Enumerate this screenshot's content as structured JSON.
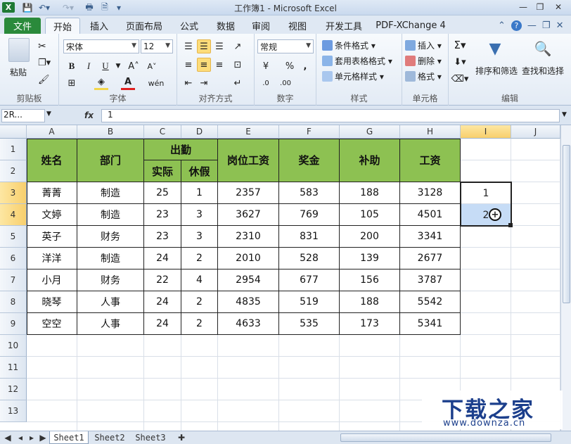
{
  "window": {
    "title": "工作簿1 - Microsoft Excel",
    "app_icon": "excel-icon",
    "quick_access": [
      "save-icon",
      "undo-icon",
      "redo-icon",
      "print-preview-icon",
      "new-icon",
      "customize-icon"
    ]
  },
  "tabs": [
    "文件",
    "开始",
    "插入",
    "页面布局",
    "公式",
    "数据",
    "审阅",
    "视图",
    "开发工具",
    "PDF-XChange 4"
  ],
  "active_tab": "开始",
  "ribbon": {
    "clipboard": {
      "paste": "粘贴",
      "label": "剪贴板"
    },
    "font": {
      "name": "宋体",
      "size": "12",
      "label": "字体",
      "font_color": "#e02020",
      "fill_color": "#f2d64b"
    },
    "alignment": {
      "label": "对齐方式"
    },
    "number": {
      "format": "常规",
      "label": "数字",
      "percent": "%",
      "comma": ","
    },
    "styles": {
      "conditional": "条件格式",
      "table_format": "套用表格格式",
      "cell_styles": "单元格样式",
      "label": "样式"
    },
    "cells": {
      "insert": "插入",
      "delete": "删除",
      "format": "格式",
      "label": "单元格"
    },
    "editing": {
      "sort_filter": "排序和筛选",
      "find_select": "查找和选择",
      "label": "编辑"
    }
  },
  "formula_bar": {
    "name_box": "2R...",
    "fx": "fx",
    "value": "1"
  },
  "columns": [
    "A",
    "B",
    "C",
    "D",
    "E",
    "F",
    "G",
    "H",
    "I",
    "J"
  ],
  "rows": [
    "1",
    "2",
    "3",
    "4",
    "5",
    "6",
    "7",
    "8",
    "9",
    "10",
    "11",
    "12",
    "13"
  ],
  "table": {
    "header_color": "#8dc152",
    "headers": {
      "name": "姓名",
      "dept": "部门",
      "attendance": "出勤",
      "actual": "实际",
      "leave": "休假",
      "base_pay": "岗位工资",
      "bonus": "奖金",
      "allowance": "补助",
      "salary": "工资"
    },
    "rows": [
      [
        "菁菁",
        "制造",
        "25",
        "1",
        "2357",
        "583",
        "188",
        "3128"
      ],
      [
        "文婷",
        "制造",
        "23",
        "3",
        "3627",
        "769",
        "105",
        "4501"
      ],
      [
        "英子",
        "财务",
        "23",
        "3",
        "2310",
        "831",
        "200",
        "3341"
      ],
      [
        "洋洋",
        "制造",
        "24",
        "2",
        "2010",
        "528",
        "139",
        "2677"
      ],
      [
        "小月",
        "财务",
        "22",
        "4",
        "2954",
        "677",
        "156",
        "3787"
      ],
      [
        "晓琴",
        "人事",
        "24",
        "2",
        "4835",
        "519",
        "188",
        "5542"
      ],
      [
        "空空",
        "人事",
        "24",
        "2",
        "4633",
        "535",
        "173",
        "5341"
      ]
    ]
  },
  "column_i": {
    "i3": "1",
    "i4": "2"
  },
  "sheet_tabs": [
    "Sheet1",
    "Sheet2",
    "Sheet3"
  ],
  "active_sheet": "Sheet1",
  "watermark": {
    "text": "下载之家",
    "url": "www.downza.cn"
  }
}
